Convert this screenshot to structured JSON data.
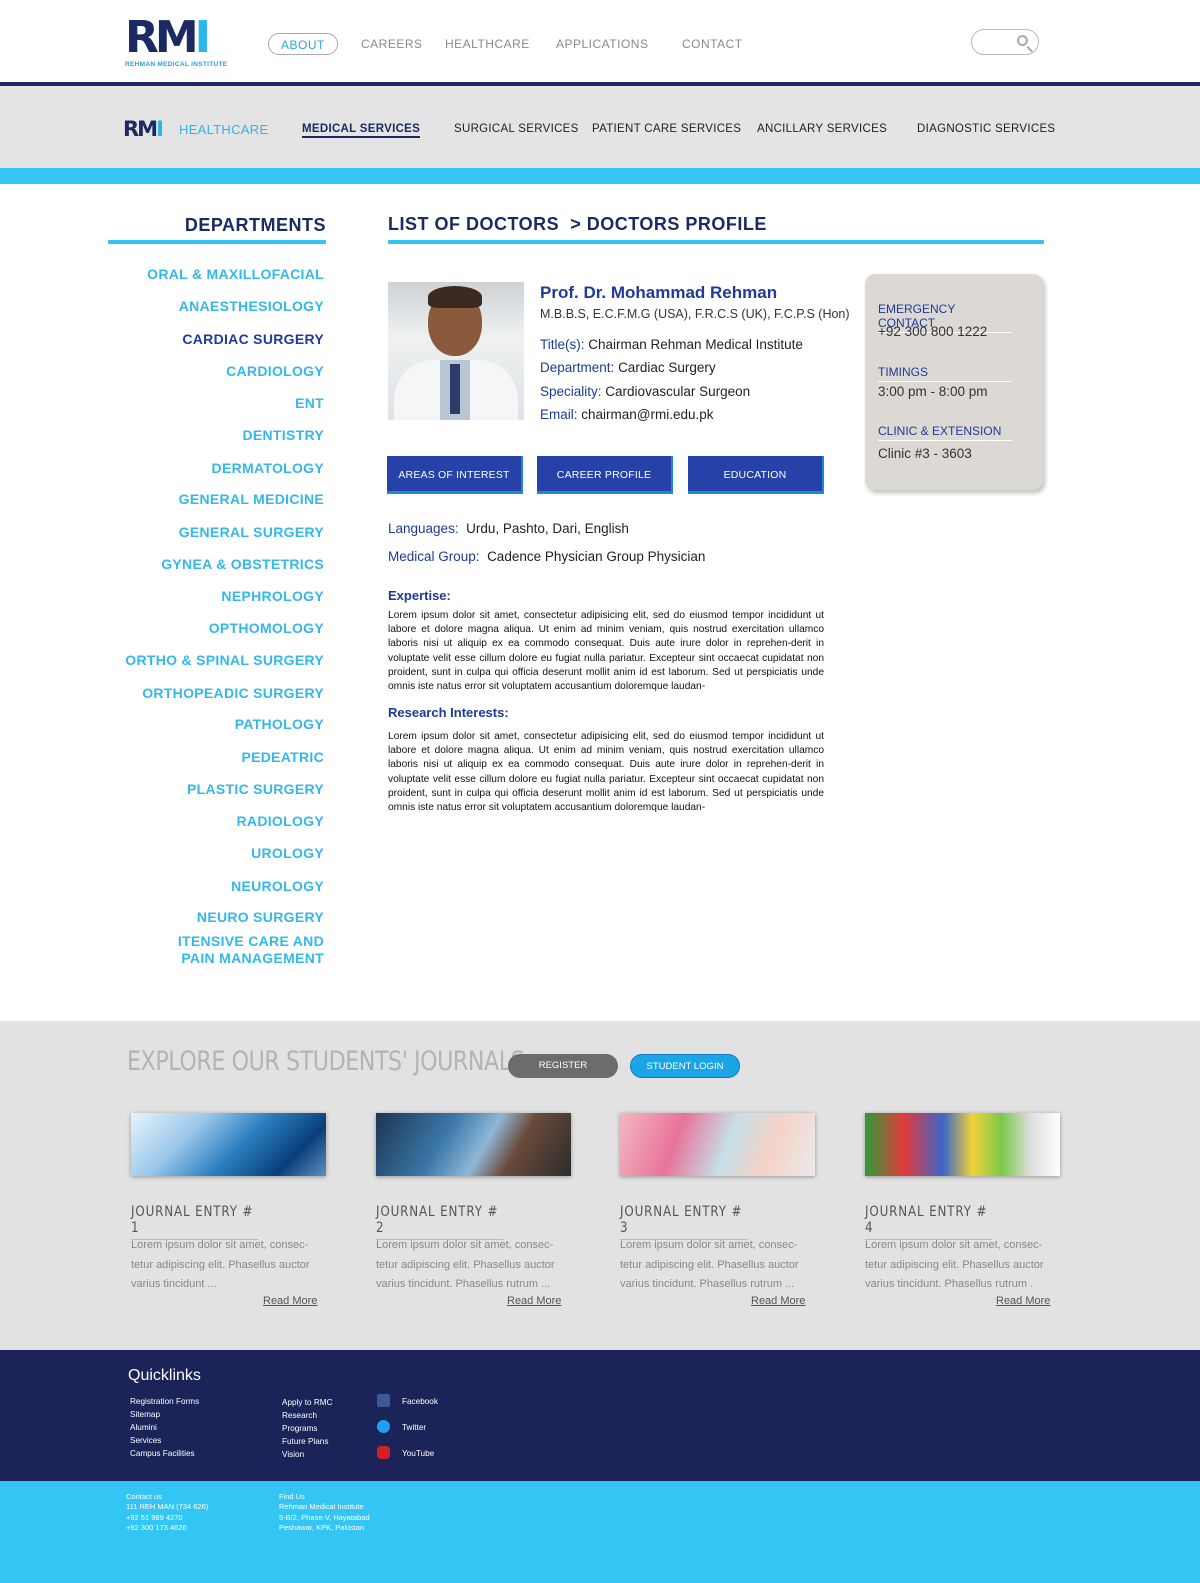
{
  "header": {
    "logo_text": "RM",
    "logo_text_i": "I",
    "logo_subtitle": "REHMAN MEDICAL INSTITUTE",
    "nav": [
      "ABOUT",
      "CAREERS",
      "HEALTHCARE",
      "APPLICATIONS",
      "CONTACT"
    ],
    "active_nav": "ABOUT"
  },
  "subnav": {
    "logo_text": "RM",
    "logo_text_i": "I",
    "section": "HEALTHCARE",
    "items": [
      "MEDICAL SERVICES",
      "SURGICAL SERVICES",
      "PATIENT CARE SERVICES",
      "ANCILLARY SERVICES",
      "DIAGNOSTIC SERVICES"
    ],
    "active": "MEDICAL SERVICES"
  },
  "departments": {
    "title": "DEPARTMENTS",
    "items": [
      "ORAL & MAXILLOFACIAL",
      "ANAESTHESIOLOGY",
      "CARDIAC SURGERY",
      "CARDIOLOGY",
      "ENT",
      "DENTISTRY",
      "DERMATOLOGY",
      "GENERAL MEDICINE",
      "GENERAL SURGERY",
      "GYNEA & OBSTETRICS",
      "NEPHROLOGY",
      "OPTHOMOLOGY",
      "ORTHO & SPINAL SURGERY",
      "ORTHOPEADIC SURGERY",
      "PATHOLOGY",
      "PEDEATRIC",
      "PLASTIC SURGERY",
      "RADIOLOGY",
      "UROLOGY",
      "NEUROLOGY",
      "NEURO SURGERY",
      "ITENSIVE CARE AND",
      "PAIN MANAGEMENT"
    ],
    "active": "CARDIAC SURGERY"
  },
  "breadcrumb": {
    "parent": "LIST OF DOCTORS",
    "current": "> DOCTORS PROFILE"
  },
  "doctor": {
    "name": "Prof. Dr. Mohammad Rehman",
    "qualifications": "M.B.B.S, E.C.F.M.G (USA), F.R.C.S (UK), F.C.P.S (Hon)",
    "fields": [
      {
        "label": "Title(s):",
        "value": "Chairman Rehman Medical Institute"
      },
      {
        "label": "Department:",
        "value": "Cardiac Surgery"
      },
      {
        "label": "Speciality:",
        "value": "Cardiovascular Surgeon"
      },
      {
        "label": "Email:",
        "value": "chairman@rmi.edu.pk"
      }
    ],
    "tabs": [
      "AREAS OF INTEREST",
      "CAREER PROFILE",
      "EDUCATION"
    ],
    "languages_label": "Languages:",
    "languages": "Urdu, Pashto, Dari, English",
    "group_label": "Medical Group:",
    "group": "Cadence Physician Group Physician",
    "expertise_title": "Expertise:",
    "expertise_text": "Lorem ipsum dolor sit amet, consectetur adipisicing elit, sed do eiusmod tempor incididunt ut labore et dolore magna aliqua. Ut enim ad minim veniam, quis nostrud exercitation ullamco laboris nisi ut aliquip ex ea commodo consequat. Duis aute irure dolor in reprehen-derit in voluptate velit esse cillum dolore eu fugiat nulla pariatur. Excepteur sint occaecat cupidatat non proident, sunt in culpa qui officia deserunt mollit anim id est laborum. Sed ut perspiciatis unde omnis iste natus error sit voluptatem accusantium doloremque laudan-",
    "research_title": "Research Interests:",
    "research_text": "Lorem ipsum dolor sit amet, consectetur adipisicing elit, sed do eiusmod tempor incididunt ut labore et dolore magna aliqua. Ut enim ad minim veniam, quis nostrud exercitation ullamco laboris nisi ut aliquip ex ea commodo consequat. Duis aute irure dolor in reprehen-derit in voluptate velit esse cillum dolore eu fugiat nulla pariatur. Excepteur sint occaecat cupidatat non proident, sunt in culpa qui officia deserunt mollit anim id est laborum. Sed ut perspiciatis unde omnis iste natus error sit voluptatem accusantium doloremque laudan-"
  },
  "contact_card": {
    "emergency_label": "EMERGENCY CONTACT",
    "emergency_value": "+92 300 800 1222",
    "timings_label": "TIMINGS",
    "timings_value": "3:00 pm - 8:00 pm",
    "clinic_label": "CLINIC & EXTENSION",
    "clinic_value": "Clinic #3 - 3603"
  },
  "journals": {
    "title": "EXPLORE OUR STUDENTS' JOURNALS",
    "register": "REGISTER",
    "login": "STUDENT LOGIN",
    "entries": [
      {
        "title": "JOURNAL ENTRY # 1",
        "text": "Lorem ipsum dolor sit amet, consec-tetur adipiscing elit. Phasellus auctor varius tincidunt ...",
        "more": "Read More"
      },
      {
        "title": "JOURNAL ENTRY # 2",
        "text": "Lorem ipsum dolor sit amet, consec-tetur adipiscing elit. Phasellus auctor varius tincidunt. Phasellus rutrum ...",
        "more": "Read More"
      },
      {
        "title": "JOURNAL ENTRY # 3",
        "text": "Lorem ipsum dolor sit amet, consec-tetur adipiscing elit. Phasellus auctor varius tincidunt. Phasellus rutrum ...",
        "more": "Read More"
      },
      {
        "title": "JOURNAL ENTRY # 4",
        "text": "Lorem ipsum dolor sit amet, consec-tetur adipiscing elit. Phasellus auctor varius tincidunt. Phasellus rutrum .",
        "more": "Read More"
      }
    ]
  },
  "footer": {
    "title": "Quicklinks",
    "col1": [
      "Registration Forms",
      "Sitemap",
      "Alumini",
      "Services",
      "Campus Facilities"
    ],
    "col2": [
      "Apply to RMC",
      "Research",
      "Programs",
      "Future Plans",
      "Vision"
    ],
    "social": [
      "Facebook",
      "Twitter",
      "YouTube"
    ],
    "contact": [
      "Contact us",
      "111 REH MAN (734 626)",
      "+92 51 989 4270",
      "+92 300 173 4626"
    ],
    "find": [
      "Find Us",
      "Rehman Medical Institute",
      "5-B/2, Phase-V, Hayatabad",
      "Peshawar, KPK, Pakistan"
    ]
  }
}
